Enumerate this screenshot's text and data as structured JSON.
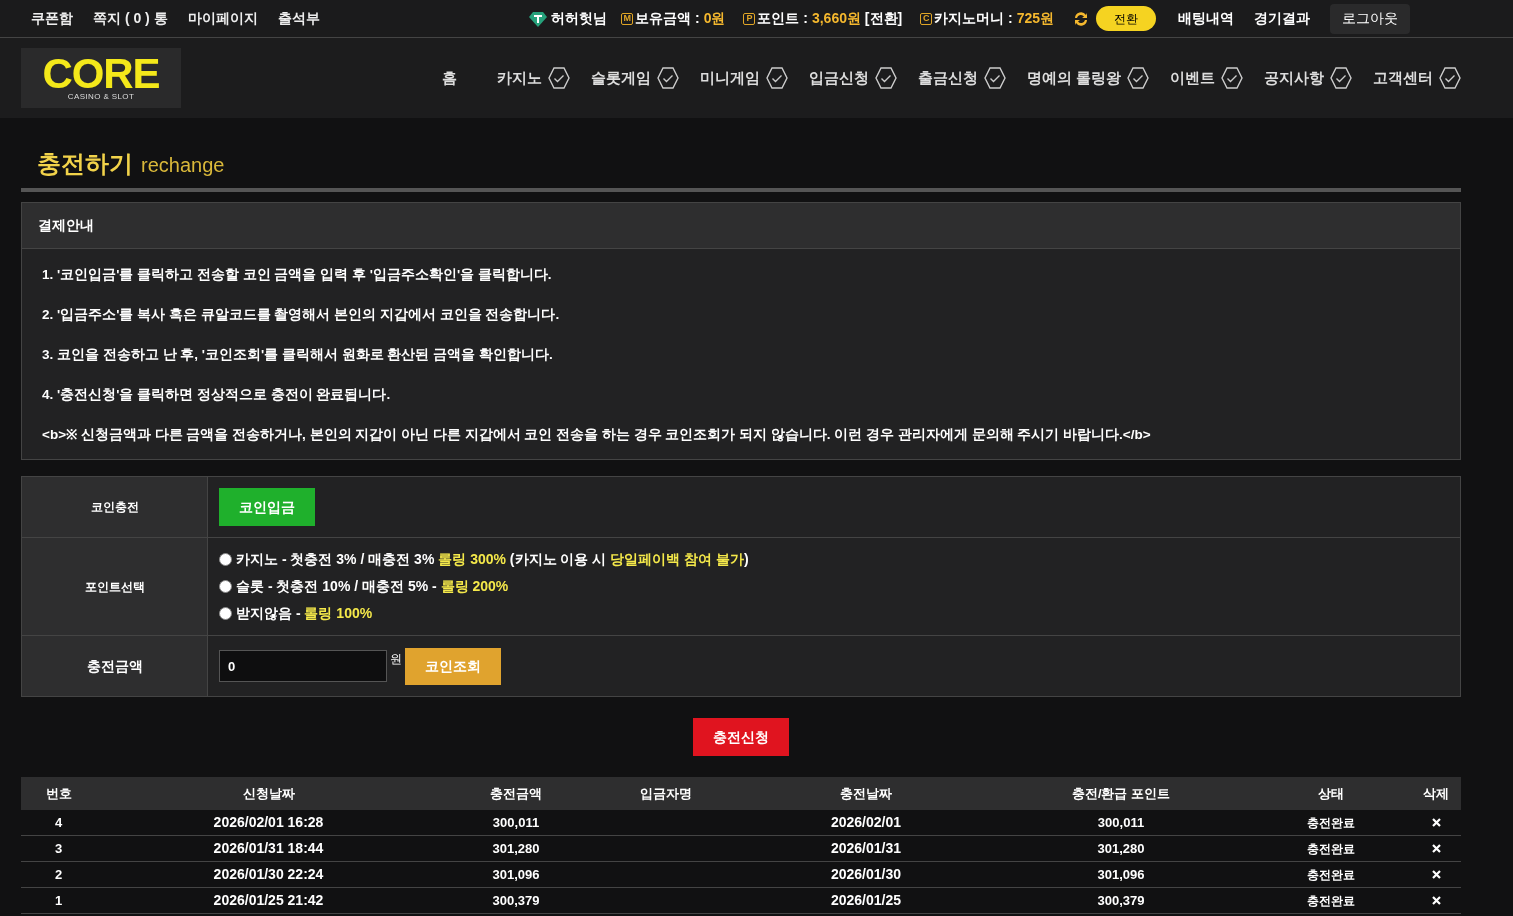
{
  "top_bar": {
    "left_links": [
      "쿠폰함",
      "쪽지 ( 0 ) 통",
      "마이페이지",
      "출석부"
    ],
    "user": "허허헛님",
    "balances": [
      {
        "badge": "M",
        "label": "보유금액 : ",
        "amount": "0원"
      },
      {
        "badge": "P",
        "label": "포인트 : ",
        "amount": "3,660원",
        "suffix": " [전환]"
      },
      {
        "badge": "C",
        "label": "카지노머니 : ",
        "amount": "725원"
      }
    ],
    "convert_button": "전환",
    "right_links": [
      "배팅내역",
      "경기결과"
    ],
    "logout_button": "로그아웃"
  },
  "logo": {
    "word": "CORE",
    "tagline": "CASINO & SLOT"
  },
  "nav": [
    {
      "label": "홈",
      "has_check": false
    },
    {
      "label": "카지노",
      "has_check": true
    },
    {
      "label": "슬롯게임",
      "has_check": true
    },
    {
      "label": "미니게임",
      "has_check": true
    },
    {
      "label": "입금신청",
      "has_check": true
    },
    {
      "label": "출금신청",
      "has_check": true
    },
    {
      "label": "명예의 롤링왕",
      "has_check": true
    },
    {
      "label": "이벤트",
      "has_check": true
    },
    {
      "label": "공지사항",
      "has_check": true
    },
    {
      "label": "고객센터",
      "has_check": true
    }
  ],
  "page_title": {
    "title": "충전하기",
    "subtitle": "rechange"
  },
  "notice": {
    "title": "결제안내",
    "lines": [
      "1. '코인입금'를 클릭하고 전송할 코인 금액을 입력 후 '입금주소확인'을 클릭합니다.",
      "2. '입금주소'를 복사 혹은 큐알코드를 촬영해서 본인의 지갑에서 코인을 전송합니다.",
      "3. 코인을 전송하고 난 후, '코인조회'를 클릭해서 원화로 환산된 금액을 확인합니다.",
      "4. '충전신청'을 클릭하면 정상적으로 충전이 완료됩니다.",
      "<b>※ 신청금액과 다른 금액을 전송하거나, 본인의 지갑이 아닌 다른 지갑에서 코인 전송을 하는 경우 코인조회가 되지 않습니다. 이런 경우 관리자에게 문의해 주시기 바랍니다.</b>"
    ]
  },
  "form": {
    "coin_label": "코인충전",
    "coin_button": "코인입금",
    "point_label": "포인트선택",
    "point_options": [
      {
        "selected": false,
        "parts": [
          {
            "text": "카지노 - 첫충전 3% / 매충전 3% ",
            "highlight": false
          },
          {
            "text": "롤링 300%",
            "highlight": true
          },
          {
            "text": " (카지노 이용 시 ",
            "highlight": false
          },
          {
            "text": "당일페이백 참여 불가",
            "highlight": true
          },
          {
            "text": ")",
            "highlight": false
          }
        ]
      },
      {
        "selected": false,
        "parts": [
          {
            "text": "슬롯 - 첫충전 10% / 매충전 5% - ",
            "highlight": false
          },
          {
            "text": "롤링 200%",
            "highlight": true
          }
        ]
      },
      {
        "selected": false,
        "parts": [
          {
            "text": "받지않음 - ",
            "highlight": false
          },
          {
            "text": "롤링 100%",
            "highlight": true
          }
        ]
      }
    ],
    "amount_label": "충전금액",
    "amount_value": "0",
    "amount_unit": "원",
    "check_button": "코인조회"
  },
  "submit_button": "충전신청",
  "table": {
    "columns": [
      "번호",
      "신청날짜",
      "충전금액",
      "입금자명",
      "충전날짜",
      "충전/환급 포인트",
      "상태",
      "삭제"
    ],
    "rows": [
      {
        "no": "4",
        "requested": "2026/02/01 16:28",
        "amount": "300,011",
        "charged": "2026/02/01",
        "points": "300,011",
        "status": "충전완료"
      },
      {
        "no": "3",
        "requested": "2026/01/31 18:44",
        "amount": "301,280",
        "charged": "2026/01/31",
        "points": "301,280",
        "status": "충전완료"
      },
      {
        "no": "2",
        "requested": "2026/01/30 22:24",
        "amount": "301,096",
        "charged": "2026/01/30",
        "points": "301,096",
        "status": "충전완료"
      },
      {
        "no": "1",
        "requested": "2026/01/25 21:42",
        "amount": "300,379",
        "charged": "2026/01/25",
        "points": "300,379",
        "status": "충전완료"
      }
    ]
  }
}
